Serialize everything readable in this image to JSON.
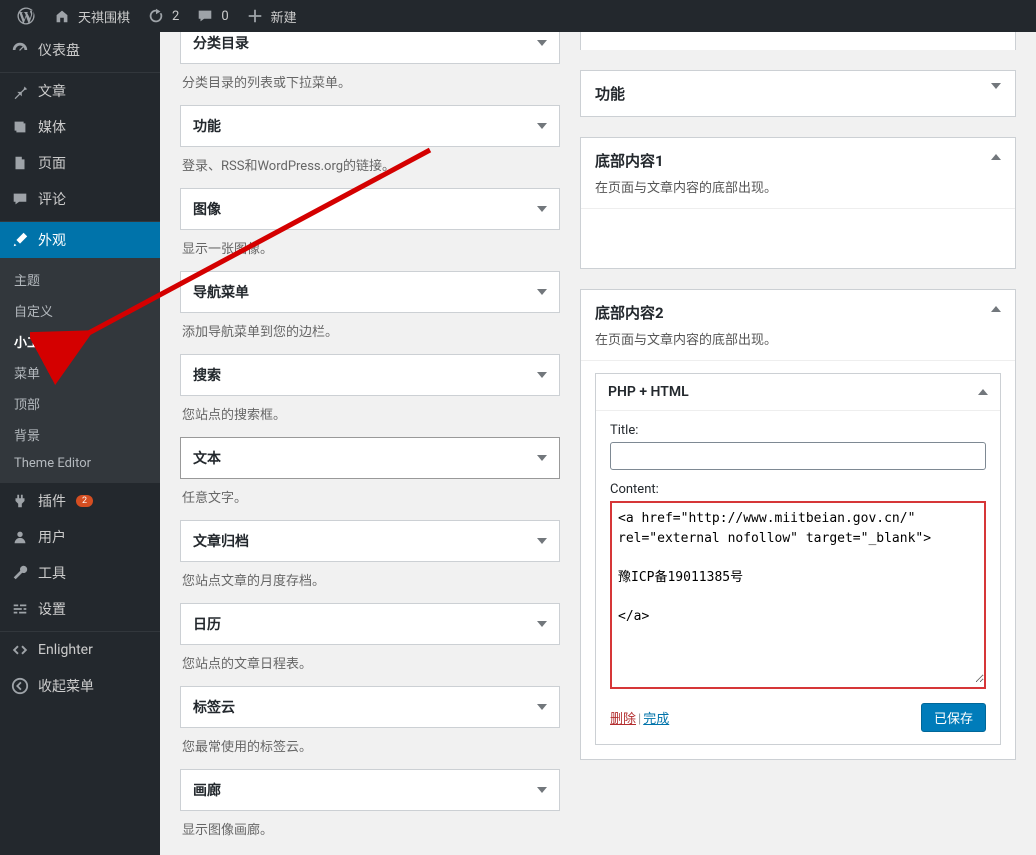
{
  "adminbar": {
    "site_name": "天祺围棋",
    "refresh_count": "2",
    "comment_count": "0",
    "new_label": "新建"
  },
  "menu": {
    "dashboard": "仪表盘",
    "posts": "文章",
    "media": "媒体",
    "pages": "页面",
    "comments": "评论",
    "appearance": "外观",
    "appearance_sub": {
      "themes": "主题",
      "customize": "自定义",
      "widgets": "小工具",
      "menus": "菜单",
      "header": "顶部",
      "background": "背景",
      "editor": "Theme Editor"
    },
    "plugins": "插件",
    "plugins_badge": "2",
    "users": "用户",
    "tools": "工具",
    "settings": "设置",
    "enlighter": "Enlighter",
    "collapse": "收起菜单"
  },
  "available_widgets": [
    {
      "title": "分类目录",
      "desc": "分类目录的列表或下拉菜单。"
    },
    {
      "title": "功能",
      "desc": "登录、RSS和WordPress.org的链接。"
    },
    {
      "title": "图像",
      "desc": "显示一张图像。"
    },
    {
      "title": "导航菜单",
      "desc": "添加导航菜单到您的边栏。"
    },
    {
      "title": "搜索",
      "desc": "您站点的搜索框。"
    },
    {
      "title": "文本",
      "desc": "任意文字。",
      "selected": true
    },
    {
      "title": "文章归档",
      "desc": "您站点文章的月度存档。"
    },
    {
      "title": "日历",
      "desc": "您站点的文章日程表。"
    },
    {
      "title": "标签云",
      "desc": "您最常使用的标签云。"
    },
    {
      "title": "画廊",
      "desc": "显示图像画廊。"
    }
  ],
  "sidebars": {
    "features": {
      "title": "功能"
    },
    "footer1": {
      "title": "底部内容1",
      "desc": "在页面与文章内容的底部出现。"
    },
    "footer2": {
      "title": "底部内容2",
      "desc": "在页面与文章内容的底部出现。",
      "widget": {
        "name": "PHP + HTML",
        "title_label": "Title:",
        "title_value": "",
        "content_label": "Content:",
        "content_value": "<a href=\"http://www.miitbeian.gov.cn/\" rel=\"external nofollow\" target=\"_blank\">\n\n豫ICP备19011385号\n\n</a>",
        "delete": "删除",
        "done": "完成",
        "saved": "已保存"
      }
    }
  }
}
